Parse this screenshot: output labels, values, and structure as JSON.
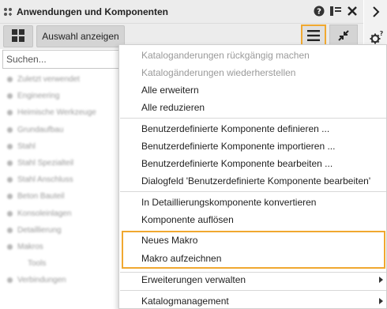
{
  "titlebar": {
    "title": "Anwendungen und Komponenten",
    "icons": [
      "app-icon",
      "help-icon",
      "layout-icon",
      "close-icon"
    ]
  },
  "toolbar": {
    "select_label": "Auswahl anzeigen",
    "icons": [
      "grid-icon",
      "hamburger-menu-icon",
      "collapse-icon"
    ],
    "highlight_color": "#f0a830"
  },
  "search": {
    "placeholder": "Suchen..."
  },
  "tree": {
    "note": "blurred",
    "items": [
      {
        "label": "Zuletzt verwendet"
      },
      {
        "label": "Engineering"
      },
      {
        "label": "Heimische Werkzeuge"
      },
      {
        "label": "Grundaufbau"
      },
      {
        "label": "Stahl"
      },
      {
        "label": "Stahl Spezialteil"
      },
      {
        "label": "Stahl Anschluss"
      },
      {
        "label": "Beton Bauteil"
      },
      {
        "label": "Konsoleinlagen"
      },
      {
        "label": "Detaillierung"
      },
      {
        "label": "Makros"
      },
      {
        "label": "Tools"
      },
      {
        "label": "Verbindungen"
      }
    ]
  },
  "strip": {
    "icons": [
      "chevron-right-icon",
      "settings-help-icon"
    ]
  },
  "menu": {
    "items": [
      {
        "label": "Kataloganderungen rückgängig machen",
        "disabled": true
      },
      {
        "label": "Katalogänderungen wiederherstellen",
        "disabled": true
      },
      {
        "label": "Alle erweitern",
        "disabled": false
      },
      {
        "label": "Alle reduzieren",
        "disabled": false
      },
      {
        "label": "Benutzerdefinierte Komponente definieren ...",
        "disabled": false
      },
      {
        "label": "Benutzerdefinierte Komponente importieren ...",
        "disabled": false
      },
      {
        "label": "Benutzerdefinierte Komponente bearbeiten ...",
        "disabled": false
      },
      {
        "label": "Dialogfeld 'Benutzerdefinierte Komponente bearbeiten'",
        "disabled": false
      },
      {
        "label": "In Detaillierungskomponente konvertieren",
        "disabled": false
      },
      {
        "label": "Komponente auflösen",
        "disabled": false
      },
      {
        "label": "Neues Makro",
        "disabled": false
      },
      {
        "label": "Makro aufzeichnen",
        "disabled": false
      },
      {
        "label": "Erweiterungen verwalten",
        "disabled": false,
        "submenu": true
      },
      {
        "label": "Katalogmanagement",
        "disabled": false,
        "submenu": true
      }
    ]
  }
}
